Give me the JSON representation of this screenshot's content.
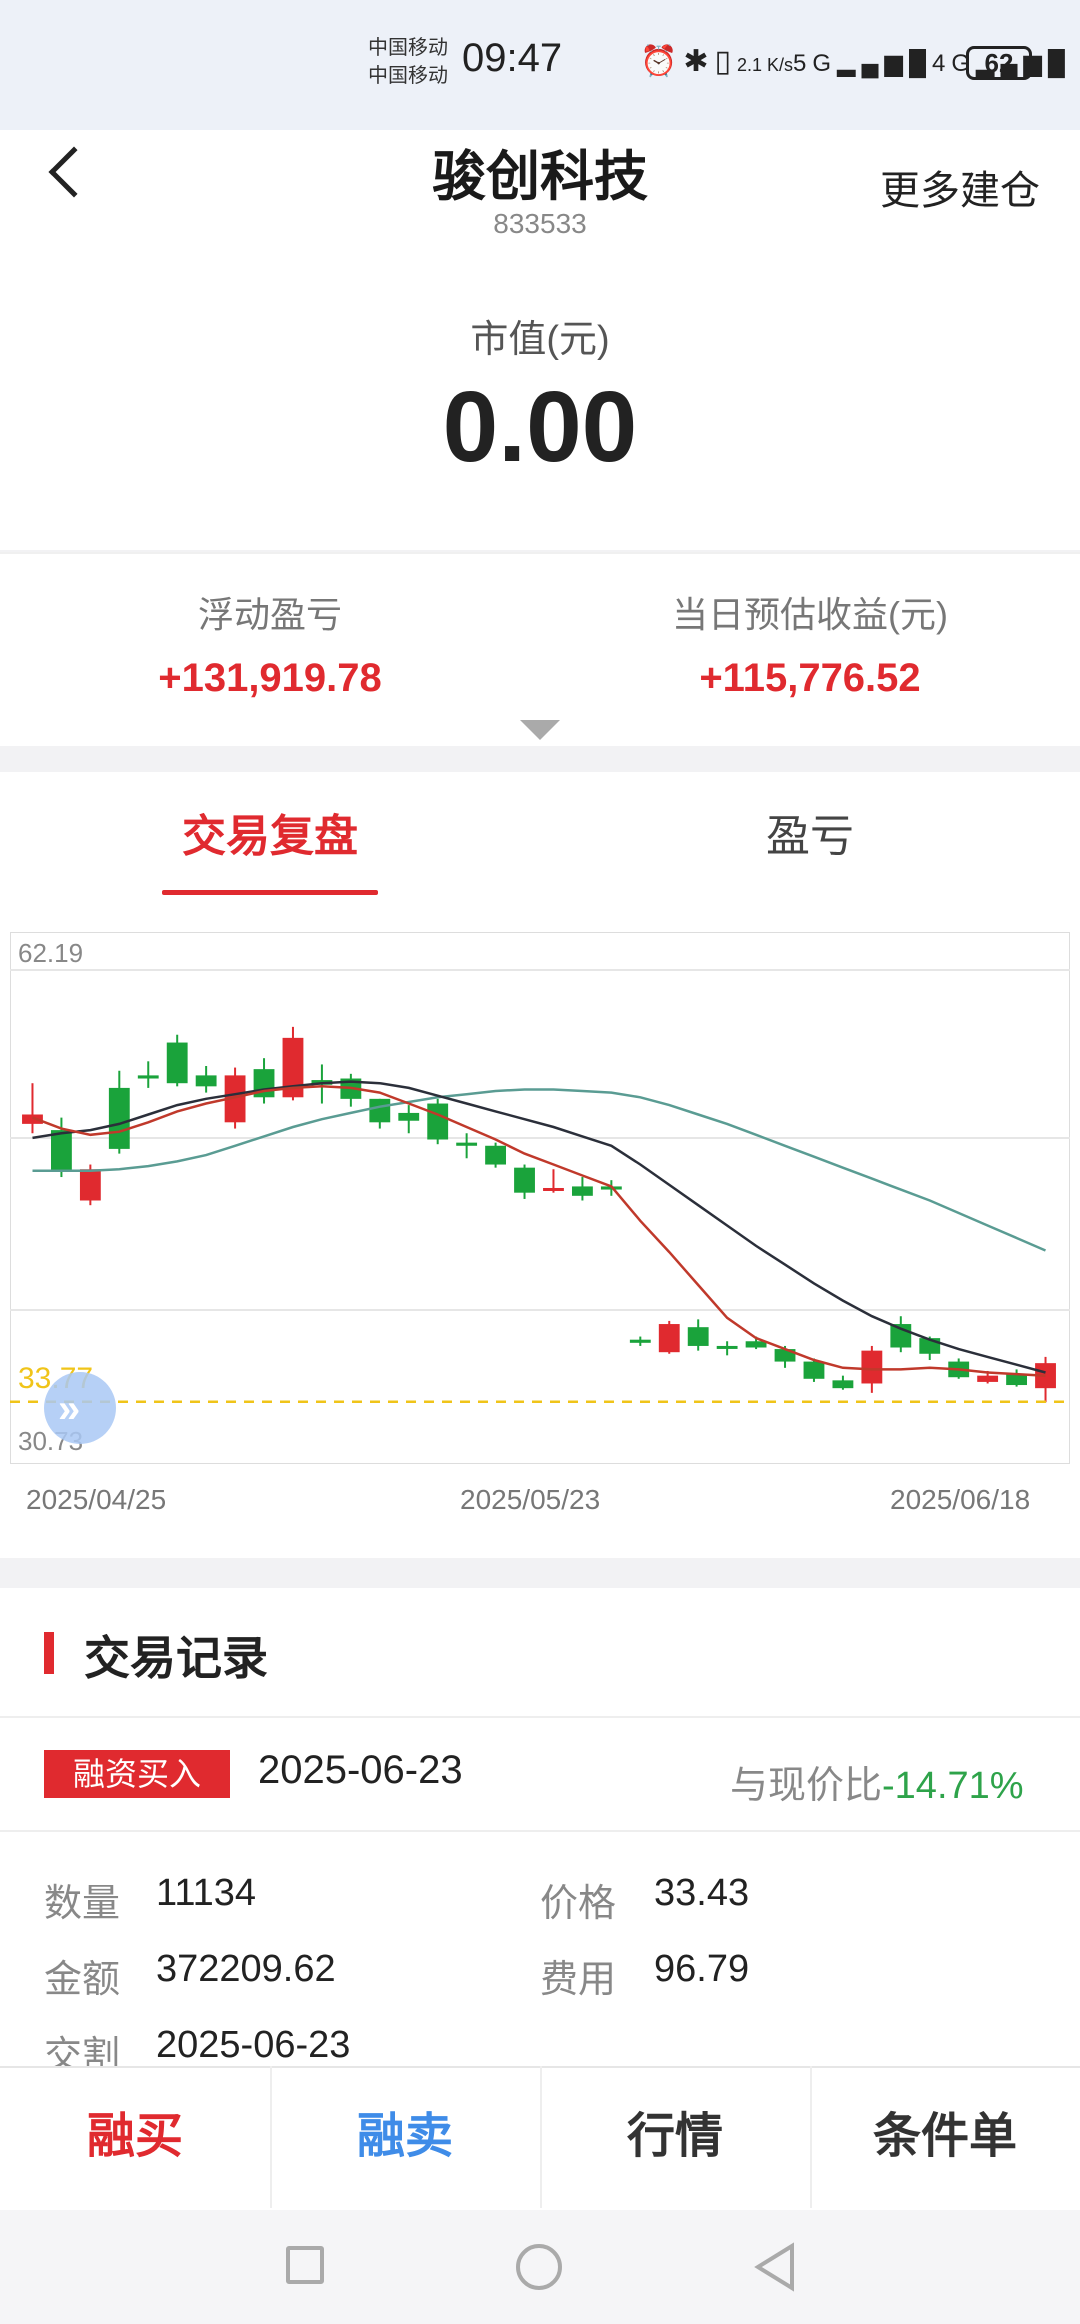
{
  "status_bar": {
    "carrier1": "中国移动",
    "carrier2": "中国移动",
    "time": "09:47",
    "icons": [
      "alarm-icon",
      "bluetooth-icon",
      "vibrate-icon",
      "net-speed",
      "5g-signal",
      "4g-signal"
    ],
    "net_speed": "2.1 K/s",
    "battery": "62"
  },
  "header": {
    "title": "骏创科技",
    "code": "833533",
    "more_label": "更多建仓",
    "market_value_label": "市值(元)",
    "market_value": "0.00"
  },
  "pnl": {
    "float_label": "浮动盈亏",
    "float_value": "+131,919.78",
    "today_label": "当日预估收益(元)",
    "today_value": "+115,776.52"
  },
  "tabs": [
    {
      "label": "交易复盘",
      "active": true
    },
    {
      "label": "盈亏",
      "active": false
    }
  ],
  "chart_data": {
    "type": "candlestick",
    "y_max_label": "62.19",
    "y_min_label": "30.73",
    "marker_label": "33.77",
    "marker_value": 33.43,
    "ylim": [
      30.73,
      62.19
    ],
    "x_labels": [
      "2025/04/25",
      "2025/05/23",
      "2025/06/18"
    ],
    "candles": [
      [
        51.2,
        51.8,
        53.8,
        50.6
      ],
      [
        50.8,
        48.2,
        51.6,
        47.8
      ],
      [
        46.3,
        48.3,
        48.6,
        46.0
      ],
      [
        53.5,
        49.6,
        54.6,
        49.3
      ],
      [
        54.3,
        54.1,
        55.2,
        53.5
      ],
      [
        56.4,
        53.8,
        56.9,
        53.6
      ],
      [
        54.3,
        53.6,
        54.9,
        53.2
      ],
      [
        51.3,
        54.3,
        54.8,
        50.9
      ],
      [
        54.7,
        52.9,
        55.4,
        52.5
      ],
      [
        52.9,
        56.7,
        57.4,
        52.7
      ],
      [
        54.0,
        53.7,
        55.0,
        52.5
      ],
      [
        54.1,
        52.8,
        54.4,
        52.3
      ],
      [
        52.8,
        51.3,
        52.8,
        50.9
      ],
      [
        51.9,
        51.4,
        52.4,
        50.6
      ],
      [
        52.5,
        50.2,
        52.8,
        49.9
      ],
      [
        50.0,
        49.8,
        50.6,
        49.0
      ],
      [
        49.8,
        48.6,
        50.0,
        48.4
      ],
      [
        48.4,
        46.8,
        48.6,
        46.4
      ],
      [
        47.1,
        47.1,
        48.3,
        46.8
      ],
      [
        47.2,
        46.6,
        47.8,
        46.3
      ],
      [
        47.2,
        47.0,
        47.6,
        46.6
      ],
      [
        37.4,
        37.2,
        37.6,
        37.0
      ],
      [
        36.6,
        38.4,
        38.6,
        36.5
      ],
      [
        38.2,
        37.0,
        38.7,
        36.7
      ],
      [
        37.0,
        36.9,
        37.3,
        36.4
      ],
      [
        37.3,
        36.9,
        37.6,
        36.8
      ],
      [
        36.8,
        36.0,
        37.0,
        35.6
      ],
      [
        36.0,
        34.9,
        36.2,
        34.7
      ],
      [
        34.8,
        34.3,
        35.1,
        34.2
      ],
      [
        34.6,
        36.7,
        37.0,
        34.0
      ],
      [
        38.4,
        36.9,
        38.9,
        36.6
      ],
      [
        37.5,
        36.5,
        37.6,
        36.1
      ],
      [
        36.0,
        35.0,
        36.2,
        34.9
      ],
      [
        34.7,
        35.1,
        35.4,
        34.6
      ],
      [
        35.2,
        34.5,
        35.5,
        34.4
      ],
      [
        34.3,
        35.9,
        36.3,
        33.4
      ]
    ],
    "ma_short": [
      51.6,
      50.9,
      50.5,
      50.7,
      51.3,
      52.0,
      52.5,
      52.9,
      53.3,
      53.5,
      53.6,
      53.5,
      53.2,
      52.5,
      51.8,
      51.0,
      50.2,
      49.3,
      48.6,
      47.9,
      47.2,
      45.0,
      43.0,
      40.9,
      38.8,
      37.5,
      36.8,
      36.1,
      35.6,
      35.5,
      35.5,
      35.6,
      35.5,
      35.3,
      35.2,
      35.1
    ],
    "ma_mid": [
      50.3,
      50.6,
      50.8,
      51.2,
      51.8,
      52.4,
      52.8,
      53.1,
      53.4,
      53.6,
      53.8,
      53.9,
      53.8,
      53.5,
      53.0,
      52.5,
      52.0,
      51.5,
      51.0,
      50.4,
      49.8,
      48.6,
      47.3,
      46.0,
      44.7,
      43.4,
      42.2,
      41.0,
      39.9,
      38.9,
      38.1,
      37.4,
      36.8,
      36.3,
      35.8,
      35.3
    ],
    "ma_long": [
      48.2,
      48.2,
      48.2,
      48.3,
      48.5,
      48.8,
      49.2,
      49.8,
      50.4,
      51.0,
      51.5,
      51.9,
      52.3,
      52.6,
      52.9,
      53.1,
      53.3,
      53.4,
      53.4,
      53.3,
      53.2,
      52.9,
      52.4,
      51.8,
      51.2,
      50.5,
      49.8,
      49.1,
      48.4,
      47.7,
      47.0,
      46.3,
      45.5,
      44.7,
      43.9,
      43.1
    ],
    "colors": {
      "up": "#e02a2f",
      "down": "#1aa33b",
      "ma_short": "#c0392b",
      "ma_mid": "#2b2f3a",
      "ma_long": "#5a9c93",
      "marker": "#f0c419"
    }
  },
  "records": {
    "title": "交易记录",
    "badge": "融资买入",
    "date": "2025-06-23",
    "ratio_label": "与现价比",
    "ratio_value": "-14.71%",
    "fields": {
      "qty_label": "数量",
      "qty": "11134",
      "price_label": "价格",
      "price": "33.43",
      "amount_label": "金额",
      "amount": "372209.62",
      "fee_label": "费用",
      "fee": "96.79",
      "settle_label": "交割",
      "settle": "2025-06-23"
    }
  },
  "bottom_bar": [
    {
      "label": "融买",
      "color": "#e02a2f"
    },
    {
      "label": "融卖",
      "color": "#3f8ce8"
    },
    {
      "label": "行情",
      "color": "#333333"
    },
    {
      "label": "条件单",
      "color": "#333333"
    }
  ]
}
